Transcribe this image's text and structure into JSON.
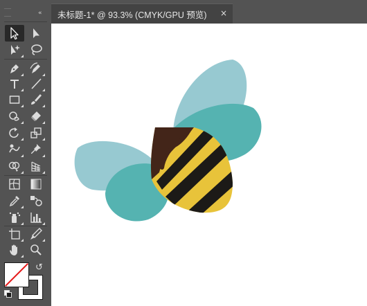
{
  "document_tab": {
    "title": "未标题-1* @ 93.3% (CMYK/GPU 预览)",
    "close_glyph": "×"
  },
  "toolbar": {
    "collapse_glyph": "«",
    "swap_glyph": "↺",
    "tools": [
      {
        "name": "selection-tool",
        "icon": "arrow-icon"
      },
      {
        "name": "direct-selection-tool",
        "icon": "white-arrow-icon"
      },
      {
        "name": "magic-wand-tool",
        "icon": "magic-wand-icon"
      },
      {
        "name": "lasso-tool",
        "icon": "lasso-icon"
      },
      {
        "name": "pen-tool",
        "icon": "pen-icon"
      },
      {
        "name": "curvature-tool",
        "icon": "curvature-pen-icon"
      },
      {
        "name": "type-tool",
        "icon": "type-icon",
        "glyph": "T"
      },
      {
        "name": "line-segment-tool",
        "icon": "line-icon"
      },
      {
        "name": "rectangle-tool",
        "icon": "rectangle-icon"
      },
      {
        "name": "paintbrush-tool",
        "icon": "brush-icon"
      },
      {
        "name": "shaper-tool",
        "icon": "shaper-icon"
      },
      {
        "name": "eraser-tool",
        "icon": "eraser-icon"
      },
      {
        "name": "rotate-tool",
        "icon": "rotate-icon"
      },
      {
        "name": "scale-tool",
        "icon": "scale-icon"
      },
      {
        "name": "warp-tool",
        "icon": "warp-icon"
      },
      {
        "name": "puppet-warp-tool",
        "icon": "pin-icon"
      },
      {
        "name": "shape-builder-tool",
        "icon": "shape-builder-icon"
      },
      {
        "name": "perspective-grid-tool",
        "icon": "perspective-grid-icon"
      },
      {
        "name": "mesh-tool",
        "icon": "mesh-icon"
      },
      {
        "name": "gradient-tool",
        "icon": "gradient-icon"
      },
      {
        "name": "eyedropper-tool",
        "icon": "eyedropper-icon"
      },
      {
        "name": "blend-tool",
        "icon": "blend-icon"
      },
      {
        "name": "symbol-sprayer-tool",
        "icon": "symbol-sprayer-icon"
      },
      {
        "name": "column-graph-tool",
        "icon": "bar-graph-icon"
      },
      {
        "name": "artboard-tool",
        "icon": "artboard-icon"
      },
      {
        "name": "slice-tool",
        "icon": "knife-icon"
      },
      {
        "name": "hand-tool",
        "icon": "hand-icon"
      },
      {
        "name": "zoom-tool",
        "icon": "magnifier-icon"
      }
    ]
  },
  "colors": {
    "fill": "none",
    "stroke": "#000000",
    "bee_wing_light": "#97c9d1",
    "bee_wing_dark": "#55b3b1",
    "bee_head": "#432519",
    "bee_stripe_yellow": "#e8c33a",
    "bee_stripe_black": "#1c1a17"
  }
}
